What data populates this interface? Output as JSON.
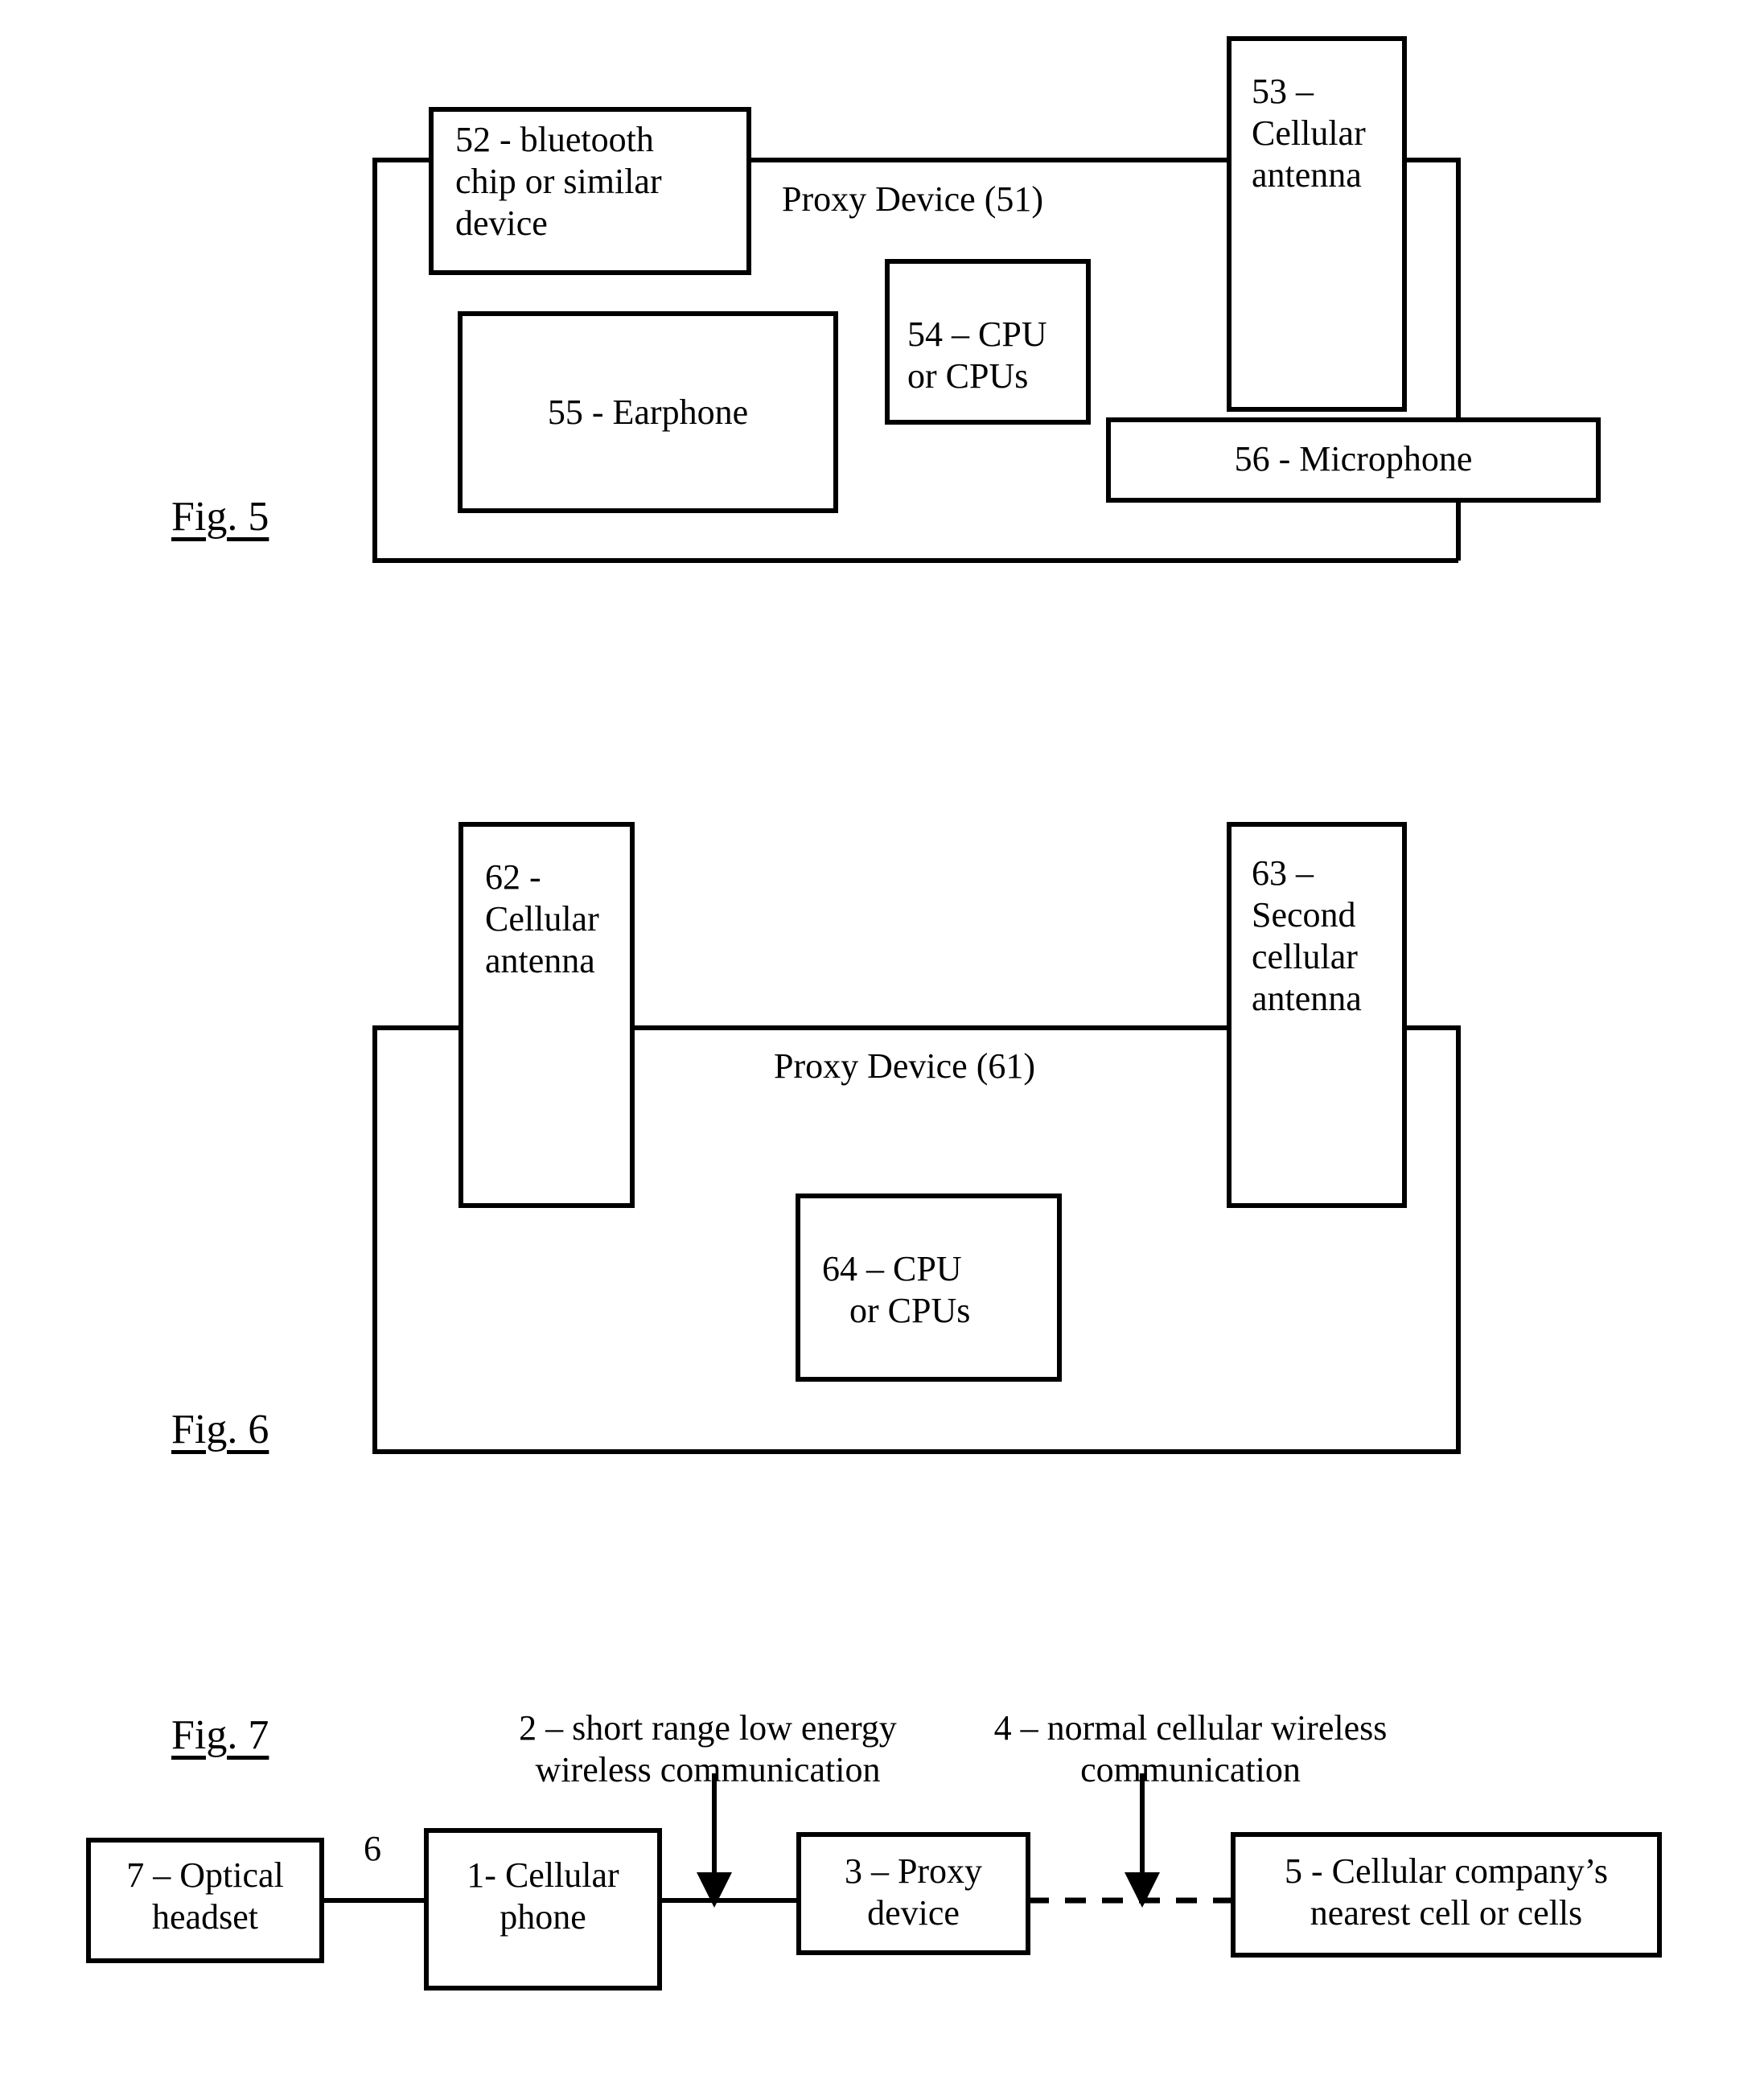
{
  "document": {
    "kind": "patent-block-diagrams",
    "page_background": "#ffffff",
    "ink_color": "#000000"
  },
  "figures": [
    {
      "id": "fig5",
      "label": "Fig. 5",
      "container_label": "Proxy Device (51)",
      "blocks": [
        {
          "ref": "52",
          "label": "52 - bluetooth chip or similar device"
        },
        {
          "ref": "53",
          "label": "53 – Cellular antenna"
        },
        {
          "ref": "54",
          "label": "54 – CPU or CPUs"
        },
        {
          "ref": "55",
          "label": "55 - Earphone"
        },
        {
          "ref": "56",
          "label": "56 - Microphone"
        }
      ]
    },
    {
      "id": "fig6",
      "label": "Fig. 6",
      "container_label": "Proxy Device (61)",
      "blocks": [
        {
          "ref": "62",
          "label": "62 - Cellular antenna"
        },
        {
          "ref": "63",
          "label": "63 – Second cellular antenna"
        },
        {
          "ref": "64",
          "label": "64 – CPU or CPUs"
        }
      ]
    },
    {
      "id": "fig7",
      "label": "Fig. 7",
      "blocks": [
        {
          "ref": "7",
          "label": "7 – Optical headset"
        },
        {
          "ref": "1",
          "label": "1- Cellular phone"
        },
        {
          "ref": "3",
          "label": "3 – Proxy device"
        },
        {
          "ref": "5",
          "label": "5 - Cellular company’s nearest cell or cells"
        }
      ],
      "annotations": [
        {
          "ref": "6",
          "label": "6"
        },
        {
          "ref": "2",
          "label": "2 – short range low energy wireless communication"
        },
        {
          "ref": "4",
          "label": "4 – normal cellular wireless communication"
        }
      ]
    }
  ],
  "fig5": {
    "fig_label": "Fig. 5",
    "proxy_label": "Proxy Device (51)",
    "b52_l1": "52 - bluetooth",
    "b52_l2": "chip or similar",
    "b52_l3": "device",
    "b53_l1": "53 –",
    "b53_l2": "Cellular",
    "b53_l3": "antenna",
    "b54_l1": "54 – CPU",
    "b54_l2": "or CPUs",
    "b55": "55 - Earphone",
    "b56": "56 - Microphone"
  },
  "fig6": {
    "fig_label": "Fig. 6",
    "proxy_label": "Proxy Device (61)",
    "b62_l1": "62 -",
    "b62_l2": "Cellular",
    "b62_l3": "antenna",
    "b63_l1": "63 –",
    "b63_l2": "Second",
    "b63_l3": "cellular",
    "b63_l4": "antenna",
    "b64_l1": "64 – CPU",
    "b64_l2": "or CPUs"
  },
  "fig7": {
    "fig_label": "Fig. 7",
    "ann2_l1": "2 – short range low energy",
    "ann2_l2": "wireless communication",
    "ann4_l1": "4 – normal cellular wireless",
    "ann4_l2": "communication",
    "ann6": "6",
    "b7_l1": "7 – Optical",
    "b7_l2": "headset",
    "b1_l1": "1- Cellular",
    "b1_l2": "phone",
    "b3_l1": "3 – Proxy",
    "b3_l2": "device",
    "b5_l1": "5 - Cellular company’s",
    "b5_l2": "nearest cell or cells"
  }
}
